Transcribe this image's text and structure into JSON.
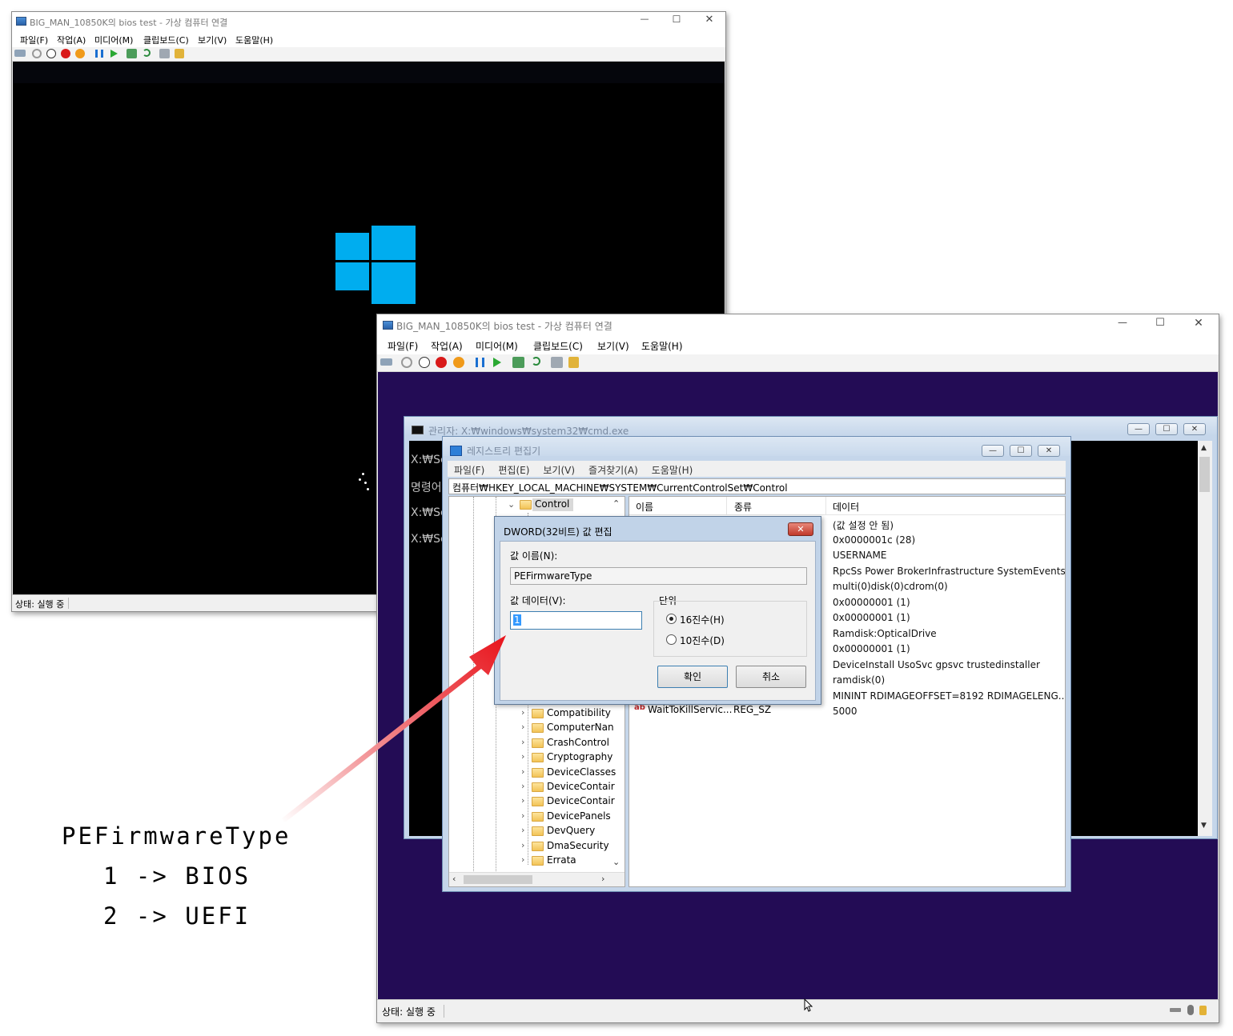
{
  "vm1": {
    "title": "BIG_MAN_10850K의 bios test - 가상 컴퓨터 연결",
    "menu": [
      "파일(F)",
      "작업(A)",
      "미디어(M)",
      "클립보드(C)",
      "보기(V)",
      "도움말(H)"
    ],
    "status": "상태: 실행 중"
  },
  "vm2": {
    "title": "BIG_MAN_10850K의 bios test - 가상 컴퓨터 연결",
    "menu": [
      "파일(F)",
      "작업(A)",
      "미디어(M)",
      "클립보드(C)",
      "보기(V)",
      "도움말(H)"
    ],
    "status": "상태: 실행 중"
  },
  "window_controls": {
    "minimize": "—",
    "maximize": "☐",
    "close": "✕"
  },
  "cmd": {
    "title": "관리자: X:₩windows₩system32₩cmd.exe",
    "lines": [
      "X:₩Sc",
      "명령어",
      "X:₩Sc",
      "X:₩Sc"
    ]
  },
  "regedit": {
    "title": "레지스트리 편집기",
    "menu": [
      "파일(F)",
      "편집(E)",
      "보기(V)",
      "즐겨찾기(A)",
      "도움말(H)"
    ],
    "address": "컴퓨터₩HKEY_LOCAL_MACHINE₩SYSTEM₩CurrentControlSet₩Control",
    "tree_selected": "Control",
    "tree_items": [
      "Compatibility",
      "ComputerNan",
      "CrashControl",
      "Cryptography",
      "DeviceClasses",
      "DeviceContair",
      "DeviceContair",
      "DevicePanels",
      "DevQuery",
      "DmaSecurity",
      "Errata"
    ],
    "columns": {
      "name": "이름",
      "type": "종류",
      "data": "데이터"
    },
    "data_values": [
      "(값 설정 안 됨)",
      "0x0000001c (28)",
      "USERNAME",
      "RpcSs Power BrokerInfrastructure SystemEventsBr...",
      "multi(0)disk(0)cdrom(0)",
      "0x00000001 (1)",
      "0x00000001 (1)",
      "Ramdisk:OpticalDrive",
      "0x00000001 (1)",
      "DeviceInstall UsoSvc gpsvc trustedinstaller",
      "ramdisk(0)",
      " MININT RDIMAGEOFFSET=8192 RDIMAGELENG...",
      "5000"
    ],
    "last_row": {
      "name": "WaitToKillServic...",
      "type": "REG_SZ",
      "icon": "ab"
    }
  },
  "dialog": {
    "title": "DWORD(32비트) 값 편집",
    "name_label": "값 이름(N):",
    "name_value": "PEFirmwareType",
    "data_label": "값 데이터(V):",
    "data_value": "1",
    "base_label": "단위",
    "radio_hex": "16진수(H)",
    "radio_dec": "10진수(D)",
    "ok": "확인",
    "cancel": "취소",
    "close": "✕"
  },
  "annotation": {
    "line1": "PEFirmwareType",
    "line2": "1 -> BIOS",
    "line3": "2 -> UEFI",
    "arrow_color": "#e8131b"
  }
}
